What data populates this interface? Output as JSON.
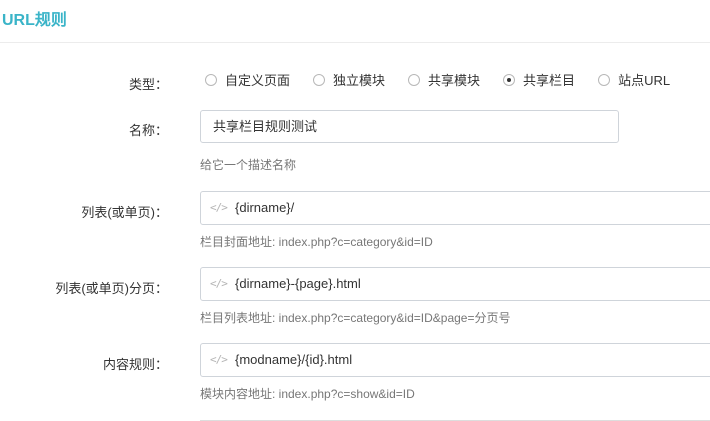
{
  "header": {
    "title": "URL规则"
  },
  "form": {
    "type": {
      "label": "类型：",
      "options": [
        {
          "label": "自定义页面",
          "checked": false
        },
        {
          "label": "独立模块",
          "checked": false
        },
        {
          "label": "共享模块",
          "checked": false
        },
        {
          "label": "共享栏目",
          "checked": true
        },
        {
          "label": "站点URL",
          "checked": false
        }
      ]
    },
    "name": {
      "label": "名称：",
      "value": "共享栏目规则测试",
      "help": "给它一个描述名称"
    },
    "list": {
      "label": "列表(或单页)：",
      "value": "{dirname}/",
      "help": "栏目封面地址: index.php?c=category&id=ID"
    },
    "list_page": {
      "label": "列表(或单页)分页：",
      "value": "{dirname}-{page}.html",
      "help": "栏目列表地址: index.php?c=category&id=ID&page=分页号"
    },
    "content": {
      "label": "内容规则：",
      "value": "{modname}/{id}.html",
      "help": "模块内容地址: index.php?c=show&id=ID"
    }
  },
  "icons": {
    "code": "code-icon"
  }
}
